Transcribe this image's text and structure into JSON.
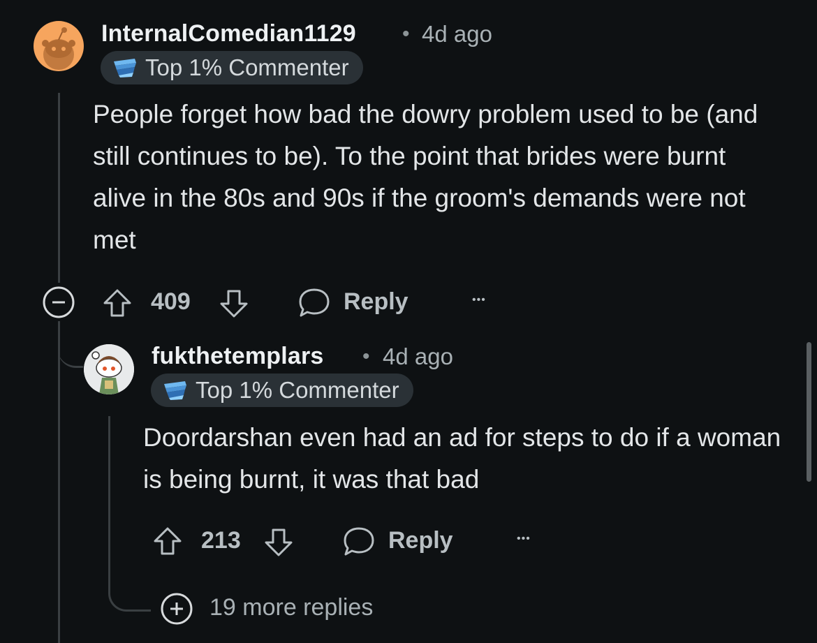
{
  "comments": [
    {
      "username": "InternalComedian1129",
      "separator": "•",
      "time": "4d ago",
      "flair": "Top 1% Commenter",
      "body": "People forget how bad the dowry problem used to be (and still continues to be). To the point that brides were burnt alive in the 80s and 90s  if the groom's demands were not met",
      "votes": "409",
      "reply_label": "Reply",
      "more_label": "•••",
      "avatar_color": "#f6a55e"
    },
    {
      "username": "fukthetemplars",
      "separator": "•",
      "time": "4d ago",
      "flair": "Top 1% Commenter",
      "body": "Doordarshan even had an ad for steps to do if a woman is being burnt, it was that bad",
      "votes": "213",
      "reply_label": "Reply",
      "more_label": "•••",
      "avatar_color": "#ffffff"
    }
  ],
  "more_replies": "19 more replies",
  "colors": {
    "background": "#0e1113",
    "thread_line": "#3a3f42",
    "flair_bg": "#2a3136"
  }
}
